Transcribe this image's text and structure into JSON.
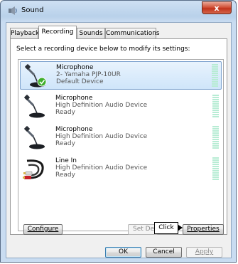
{
  "window": {
    "title": "Sound",
    "close_label": "x",
    "icon": "speaker-icon"
  },
  "tabs": [
    {
      "label": "Playback",
      "active": false
    },
    {
      "label": "Recording",
      "active": true
    },
    {
      "label": "Sounds",
      "active": false
    },
    {
      "label": "Communications",
      "active": false
    }
  ],
  "instruction": "Select a recording device below to modify its settings:",
  "devices": [
    {
      "name": "Microphone",
      "description": "2- Yamaha PJP-10UR",
      "status": "Default Device",
      "icon": "microphone-icon",
      "badge": "default-check-icon",
      "selected": true
    },
    {
      "name": "Microphone",
      "description": "High Definition Audio Device",
      "status": "Ready",
      "icon": "microphone-icon",
      "selected": false
    },
    {
      "name": "Microphone",
      "description": "High Definition Audio Device",
      "status": "Ready",
      "icon": "microphone-icon",
      "selected": false
    },
    {
      "name": "Line In",
      "description": "High Definition Audio Device",
      "status": "Ready",
      "icon": "line-in-cable-icon",
      "selected": false
    }
  ],
  "buttons": {
    "configure": "Configure",
    "set_default": "Set Def",
    "properties": "Properties",
    "ok": "OK",
    "cancel": "Cancel",
    "apply": "Apply"
  },
  "tooltip": "Click",
  "colors": {
    "meter": "#b7ecd4",
    "selection": "#cfe5fa",
    "check_badge": "#3fae2a"
  }
}
